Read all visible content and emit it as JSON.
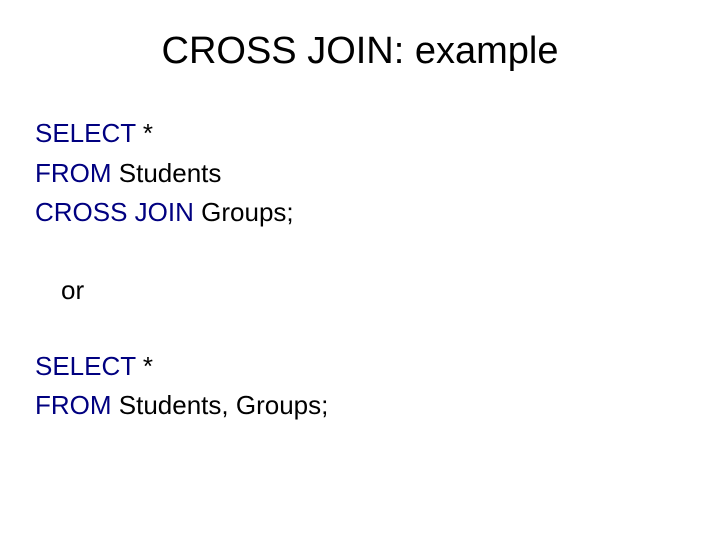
{
  "title": "CROSS JOIN: example",
  "query1": {
    "select": "SELECT",
    "star": " *",
    "from": "FROM",
    "from_rest": "  Students",
    "cross": "CROSS JOIN",
    "cross_rest": " Groups;"
  },
  "or_text": "or",
  "query2": {
    "select": "SELECT",
    "star": " *",
    "from": "FROM",
    "from_rest": " Students, Groups;"
  }
}
